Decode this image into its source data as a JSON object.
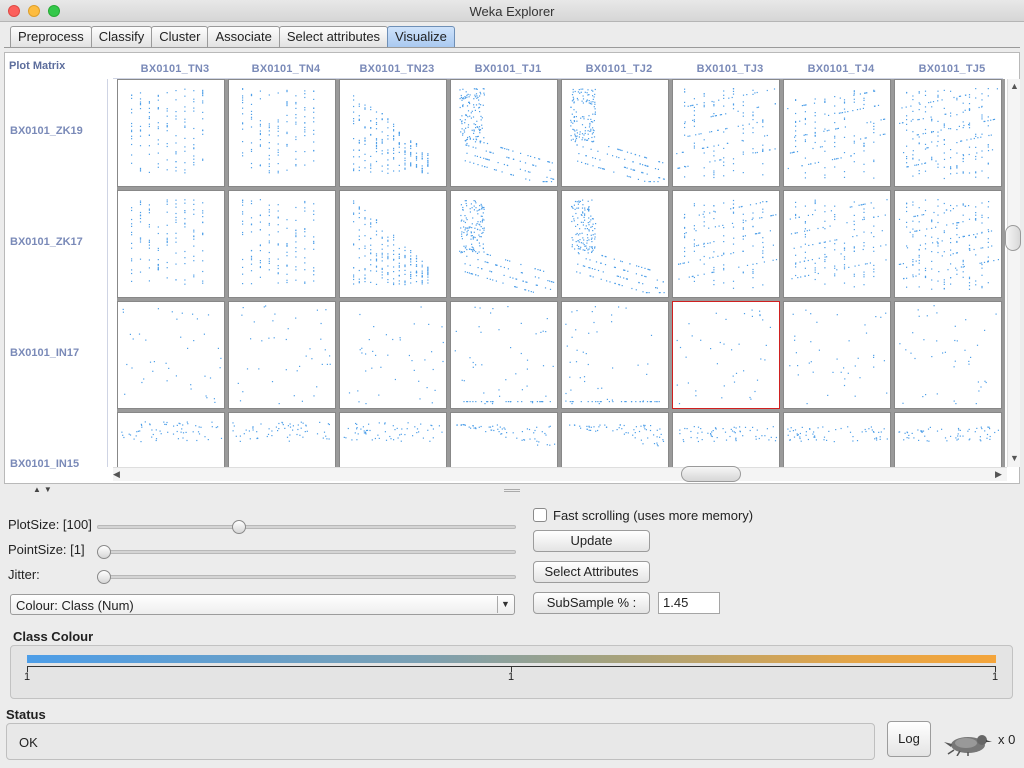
{
  "window": {
    "title": "Weka Explorer"
  },
  "tabs": [
    {
      "label": "Preprocess",
      "active": false
    },
    {
      "label": "Classify",
      "active": false
    },
    {
      "label": "Cluster",
      "active": false
    },
    {
      "label": "Associate",
      "active": false
    },
    {
      "label": "Select attributes",
      "active": false
    },
    {
      "label": "Visualize",
      "active": true
    }
  ],
  "matrix": {
    "label": "Plot Matrix",
    "columns": [
      "BX0101_TN3",
      "BX0101_TN4",
      "BX0101_TN23",
      "BX0101_TJ1",
      "BX0101_TJ2",
      "BX0101_TJ3",
      "BX0101_TJ4",
      "BX0101_TJ5"
    ],
    "rows": [
      "BX0101_ZK19",
      "BX0101_ZK17",
      "BX0101_IN17",
      "BX0101_IN15"
    ],
    "selected_cell": {
      "row": 2,
      "col": 5
    },
    "point_color": "#4d9ee8",
    "selected_border_color": "#d02020"
  },
  "controls": {
    "plot_size_label": "PlotSize: [100]",
    "plot_size_value": 100,
    "point_size_label": "PointSize: [1]",
    "point_size_value": 1,
    "jitter_label": "Jitter:",
    "jitter_value": 0,
    "colour_label": "Colour: Class  (Num)",
    "fast_scrolling_label": "Fast scrolling (uses more memory)",
    "fast_scrolling_checked": false,
    "update_label": "Update",
    "select_attributes_label": "Select Attributes",
    "subsample_label": "SubSample % :",
    "subsample_value": "1.45"
  },
  "class_colour": {
    "title": "Class Colour",
    "tick_labels": [
      "1",
      "1",
      "1"
    ],
    "gradient_start": "#4d9ee8",
    "gradient_end": "#f4a53b"
  },
  "status": {
    "title": "Status",
    "text": "OK",
    "log_label": "Log",
    "count": "x 0"
  }
}
